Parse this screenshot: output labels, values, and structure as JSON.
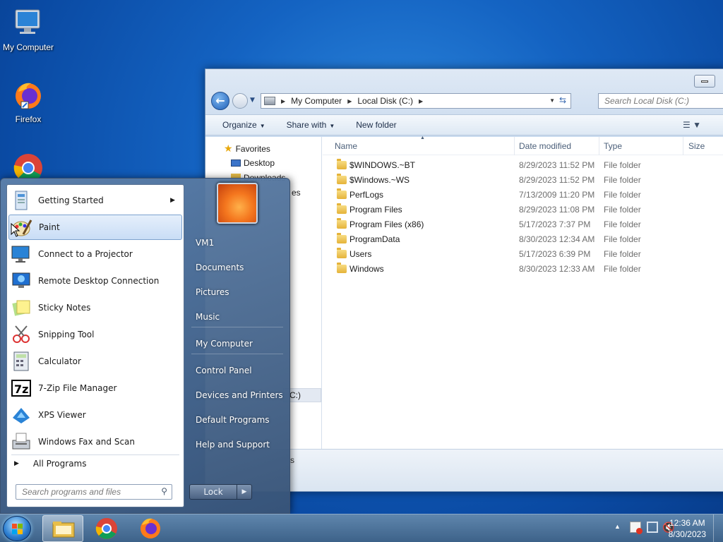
{
  "desktop": {
    "icons": [
      {
        "label": "My Computer",
        "icon": "computer-icon"
      },
      {
        "label": "Firefox",
        "icon": "firefox-icon"
      },
      {
        "label": "",
        "icon": "chrome-icon"
      }
    ]
  },
  "explorer": {
    "breadcrumb": [
      "My Computer",
      "Local Disk (C:)"
    ],
    "search_placeholder": "Search Local Disk (C:)",
    "toolbar": {
      "organize": "Organize",
      "share_with": "Share with",
      "new_folder": "New folder"
    },
    "nav_pane": {
      "favorites": "Favorites",
      "desktop": "Desktop",
      "partial_items": [
        "Downloads",
        "es",
        "C:)"
      ],
      "status_partial": "s"
    },
    "columns": {
      "name": "Name",
      "date": "Date modified",
      "type": "Type",
      "size": "Size"
    },
    "files": [
      {
        "name": "$WINDOWS.~BT",
        "date": "8/29/2023 11:52 PM",
        "type": "File folder"
      },
      {
        "name": "$Windows.~WS",
        "date": "8/29/2023 11:52 PM",
        "type": "File folder"
      },
      {
        "name": "PerfLogs",
        "date": "7/13/2009 11:20 PM",
        "type": "File folder"
      },
      {
        "name": "Program Files",
        "date": "8/29/2023 11:08 PM",
        "type": "File folder"
      },
      {
        "name": "Program Files (x86)",
        "date": "5/17/2023 7:37 PM",
        "type": "File folder"
      },
      {
        "name": "ProgramData",
        "date": "8/30/2023 12:34 AM",
        "type": "File folder"
      },
      {
        "name": "Users",
        "date": "5/17/2023 6:39 PM",
        "type": "File folder"
      },
      {
        "name": "Windows",
        "date": "8/30/2023 12:33 AM",
        "type": "File folder"
      }
    ]
  },
  "start_menu": {
    "programs": [
      {
        "label": "Getting Started",
        "icon": "getting-started-icon",
        "has_submenu": true
      },
      {
        "label": "Paint",
        "icon": "paint-icon",
        "highlighted": true
      },
      {
        "label": "Connect to a Projector",
        "icon": "projector-icon"
      },
      {
        "label": "Remote Desktop Connection",
        "icon": "remote-desktop-icon"
      },
      {
        "label": "Sticky Notes",
        "icon": "sticky-notes-icon"
      },
      {
        "label": "Snipping Tool",
        "icon": "snipping-tool-icon"
      },
      {
        "label": "Calculator",
        "icon": "calculator-icon"
      },
      {
        "label": "7-Zip File Manager",
        "icon": "7zip-icon"
      },
      {
        "label": "XPS Viewer",
        "icon": "xps-viewer-icon"
      },
      {
        "label": "Windows Fax and Scan",
        "icon": "fax-scan-icon"
      }
    ],
    "all_programs": "All Programs",
    "search_placeholder": "Search programs and files",
    "right_items": [
      "VM1",
      "Documents",
      "Pictures",
      "Music",
      "My Computer",
      "Control Panel",
      "Devices and Printers",
      "Default Programs",
      "Help and Support"
    ],
    "lock": "Lock"
  },
  "taskbar": {
    "pinned": [
      "explorer-icon",
      "chrome-icon",
      "firefox-icon"
    ],
    "time": "12:36 AM",
    "date": "8/30/2023"
  },
  "colors": {
    "accent": "#3399ff",
    "highlight": "#c9ddf6"
  }
}
